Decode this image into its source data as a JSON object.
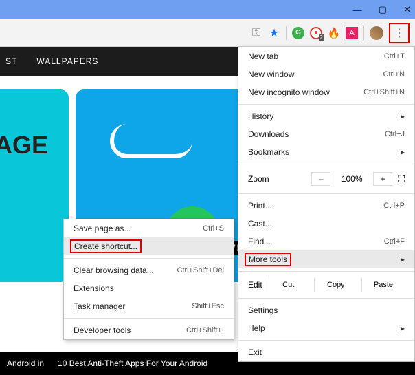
{
  "titlebar": {
    "min": "—",
    "max": "▢",
    "close": "✕"
  },
  "toolbar": {
    "key_icon": "⚿",
    "star_icon": "★",
    "g_label": "G",
    "red_badge": "●",
    "badge_count": "2",
    "flame_icon": "🔥",
    "a_label": "A",
    "kebab": "⋮"
  },
  "nav": {
    "item1": "ST",
    "item2": "WALLPAPERS"
  },
  "cards": {
    "lage": "LAGE",
    "owner": "OWNER",
    "cap1": "Android in",
    "cap2": "10 Best Anti-Theft Apps For Your Android"
  },
  "menu": {
    "newtab": "New tab",
    "newtab_k": "Ctrl+T",
    "newwin": "New window",
    "newwin_k": "Ctrl+N",
    "incog": "New incognito window",
    "incog_k": "Ctrl+Shift+N",
    "history": "History",
    "arrow": "▸",
    "downloads": "Downloads",
    "downloads_k": "Ctrl+J",
    "bookmarks": "Bookmarks",
    "zoom_l": "Zoom",
    "zoom_minus": "–",
    "zoom_pct": "100%",
    "zoom_plus": "+",
    "fullscreen": "⛶",
    "print": "Print...",
    "print_k": "Ctrl+P",
    "cast": "Cast...",
    "find": "Find...",
    "find_k": "Ctrl+F",
    "moretools": "More tools",
    "edit": "Edit",
    "cut": "Cut",
    "copy": "Copy",
    "paste": "Paste",
    "settings": "Settings",
    "help": "Help",
    "exit": "Exit"
  },
  "sub": {
    "save": "Save page as...",
    "save_k": "Ctrl+S",
    "shortcut": "Create shortcut...",
    "clear": "Clear browsing data...",
    "clear_k": "Ctrl+Shift+Del",
    "ext": "Extensions",
    "task": "Task manager",
    "task_k": "Shift+Esc",
    "dev": "Developer tools",
    "dev_k": "Ctrl+Shift+I"
  }
}
